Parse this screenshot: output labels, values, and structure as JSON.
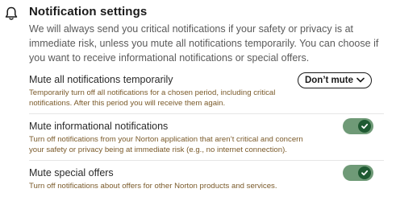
{
  "header": {
    "icon": "bell-icon",
    "title": "Notification settings",
    "intro": "We will always send you critical notifications if your safety or privacy is at immediate risk, unless you mute all notifications temporarily. You can choose if you want to receive informational notifications or special offers."
  },
  "settings": [
    {
      "title": "Mute all notifications temporarily",
      "description": "Temporarily turn off all notifications for a chosen period, including critical notifications. After this period you will receive them again.",
      "control": "dropdown",
      "value": "Don’t mute"
    },
    {
      "title": "Mute informational notifications",
      "description": "Turn off notifications from your Norton application that aren’t critical and concern your safety or privacy being at immediate risk (e.g., no internet connection).",
      "control": "toggle",
      "checked": true
    },
    {
      "title": "Mute special offers",
      "description": "Turn off notifications about offers for other Norton products and services.",
      "control": "toggle",
      "checked": true
    }
  ],
  "colors": {
    "toggle_track": "#6f9a77",
    "toggle_knob": "#1f5a32",
    "description_text": "#7a5a2a"
  }
}
